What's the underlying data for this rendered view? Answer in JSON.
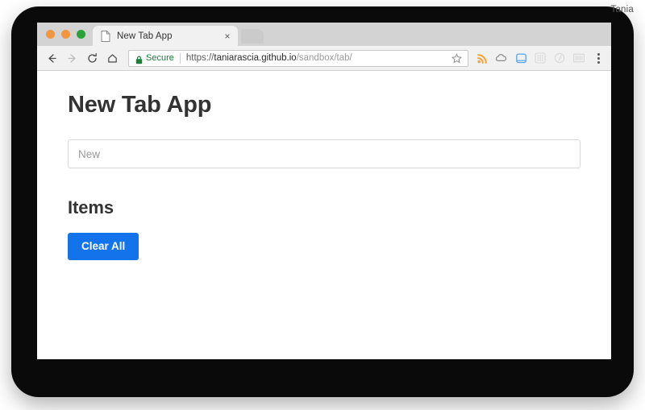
{
  "browser": {
    "traffic_lights": [
      {
        "name": "close",
        "color": "#f2973f"
      },
      {
        "name": "minimize",
        "color": "#f2973f"
      },
      {
        "name": "maximize",
        "color": "#2aa236"
      }
    ],
    "tab": {
      "title": "New Tab App",
      "favicon": "document-icon",
      "close_label": "×"
    },
    "new_tab_label": "+",
    "profile_name": "Tania",
    "nav": {
      "back": "back-arrow-icon",
      "forward": "forward-arrow-icon",
      "reload": "reload-icon",
      "home": "home-icon"
    },
    "omnibox": {
      "lock_icon": "lock-icon",
      "secure_label": "Secure",
      "url_scheme": "https://",
      "url_host": "taniarascia.github.io",
      "url_path": "/sandbox/tab/",
      "star_icon": "star-icon"
    },
    "extensions": [
      {
        "name": "rss-feed-icon",
        "color": "#f5a033"
      },
      {
        "name": "cloud-icon",
        "color": "#8a8a8a"
      },
      {
        "name": "pocket-icon",
        "color": "#5aaaf0"
      },
      {
        "name": "grid-icon",
        "color": "#d8d8d8"
      },
      {
        "name": "circle-slash-icon",
        "color": "#d8d8d8"
      },
      {
        "name": "barcode-icon",
        "color": "#d2d2d2"
      }
    ],
    "menu_icon": "three-dot-menu-icon"
  },
  "page": {
    "title": "New Tab App",
    "input": {
      "value": "",
      "placeholder": "New"
    },
    "section_title": "Items",
    "items": [],
    "clear_all_label": "Clear All",
    "accent_color": "#1273eb"
  }
}
